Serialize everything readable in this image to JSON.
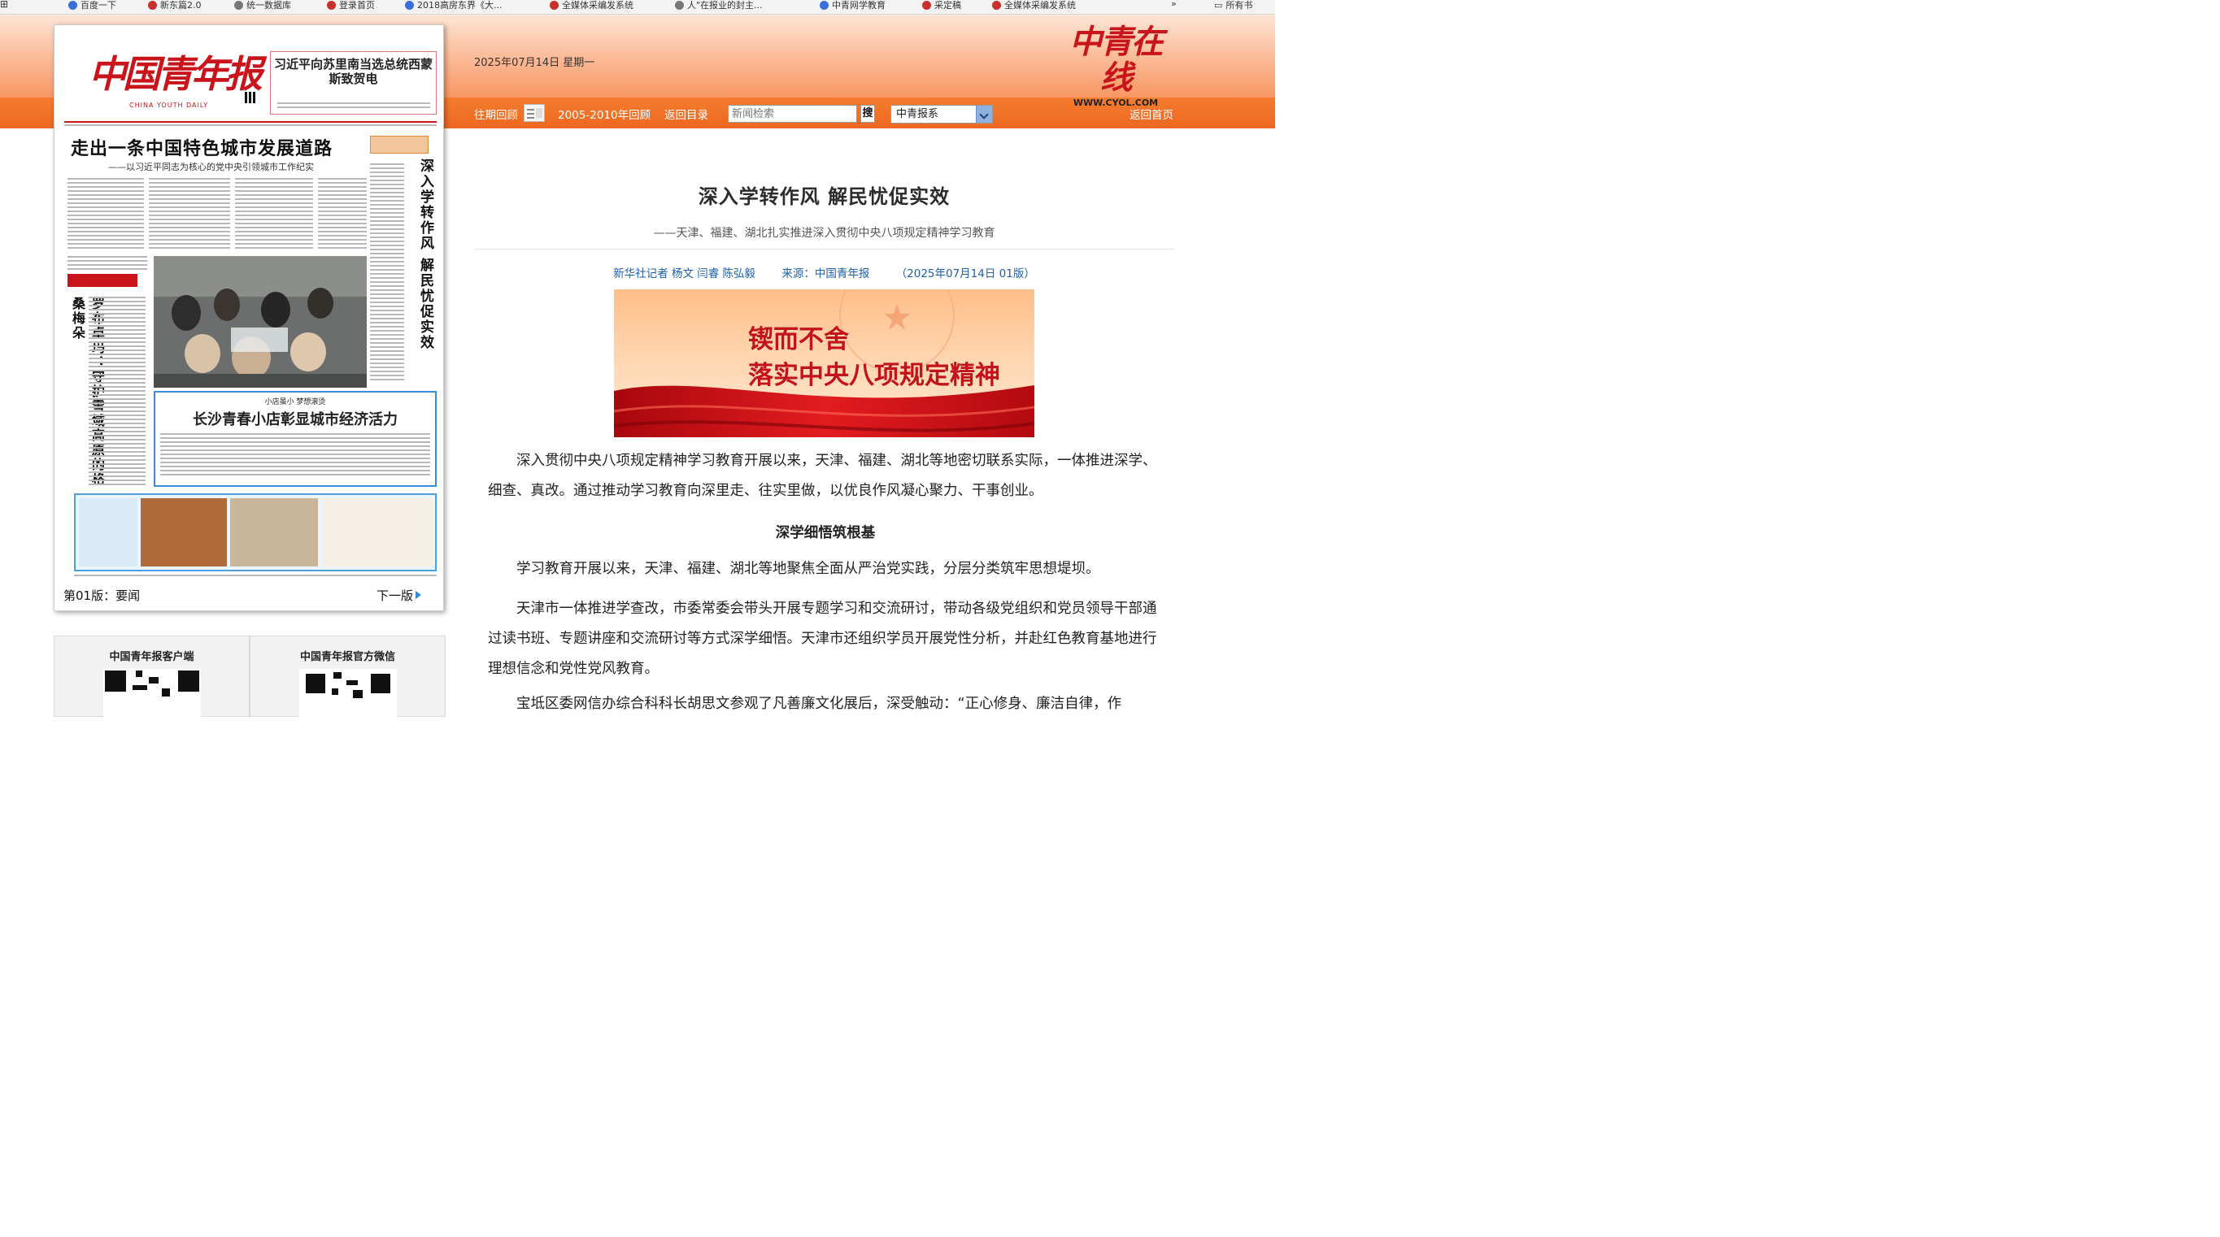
{
  "browser": {
    "bookmarks": [
      {
        "icon": "grid-icon",
        "label": "",
        "color": "#666666"
      },
      {
        "icon": "baidu-icon",
        "label": "百度一下",
        "color": "#3b6fd8"
      },
      {
        "icon": "site-icon",
        "label": "新东篇2.0",
        "color": "#c8312b"
      },
      {
        "icon": "site-icon",
        "label": "统一数据库",
        "color": "#777777"
      },
      {
        "icon": "site-icon",
        "label": "登录首页",
        "color": "#c8312b"
      },
      {
        "icon": "site-icon",
        "label": "2018高房东界《大...",
        "color": "#3b6fd8"
      },
      {
        "icon": "site-icon",
        "label": "全媒体采编发系统",
        "color": "#c8312b"
      },
      {
        "icon": "site-icon",
        "label": "人\"在报业的封主...",
        "color": "#777777"
      },
      {
        "icon": "site-icon",
        "label": "中青网学教育",
        "color": "#3b6fd8"
      },
      {
        "icon": "site-icon",
        "label": "采定稿",
        "color": "#c8312b"
      },
      {
        "icon": "site-icon",
        "label": "全媒体采编发系统",
        "color": "#c8312b"
      }
    ],
    "more": "»",
    "all_bookmarks": "所有书"
  },
  "header": {
    "date": "2025年07月14日 星期一",
    "logo_text": "中青在线",
    "logo_url": "WWW.CYOL.COM",
    "nav": {
      "archive": "往期回顾",
      "archive_2005": "2005-2010年回顾",
      "back_to_index": "返回目录",
      "search_placeholder": "新闻检索",
      "search_button": "搜",
      "paper_select": "中青报系",
      "home": "返回首页"
    }
  },
  "paper": {
    "masthead": "中国青年报",
    "masthead_en": "CHINA YOUTH DAILY",
    "top_headline": "习近平向苏里南当选总统西蒙斯致贺电",
    "main_headline": "走出一条中国特色城市发展道路",
    "main_subhead": "——以习近平同志为核心的党中央引领城市工作纪实",
    "right_vertical": "深入学转作风 解民忧促实效",
    "left_vertical": "罗布卓玛：守护雪域高原的格桑梅朵",
    "story_kicker": "小店虽小 梦想滚烫",
    "story_headline": "长沙青春小店彰显城市经济活力",
    "page_label": "第01版：要闻",
    "next_page": "下一版"
  },
  "qr": [
    {
      "label": "中国青年报客户端"
    },
    {
      "label": "中国青年报官方微信"
    }
  ],
  "article": {
    "title": "深入学转作风 解民忧促实效",
    "subtitle": "——天津、福建、湖北扎实推进深入贯彻中央八项规定精神学习教育",
    "author": "新华社记者 杨文 闫睿 陈弘毅",
    "source": "来源：中国青年报",
    "date_edition": "（2025年07月14日 01版）",
    "banner_line1": "锲而不舍",
    "banner_line2": "落实中央八项规定精神",
    "para1": "深入贯彻中央八项规定精神学习教育开展以来，天津、福建、湖北等地密切联系实际，一体推进深学、细查、真改。通过推动学习教育向深里走、往实里做，以优良作风凝心聚力、干事创业。",
    "section1": "深学细悟筑根基",
    "para2": "学习教育开展以来，天津、福建、湖北等地聚焦全面从严治党实践，分层分类筑牢思想堤坝。",
    "para3": "天津市一体推进学查改，市委常委会带头开展专题学习和交流研讨，带动各级党组织和党员领导干部通过读书班、专题讲座和交流研讨等方式深学细悟。天津市还组织学员开展党性分析，并赴红色教育基地进行理想信念和党性党风教育。",
    "para4": "宝坻区委网信办综合科科长胡思文参观了凡善廉文化展后，深受触动：“正心修身、廉洁自律，作"
  }
}
